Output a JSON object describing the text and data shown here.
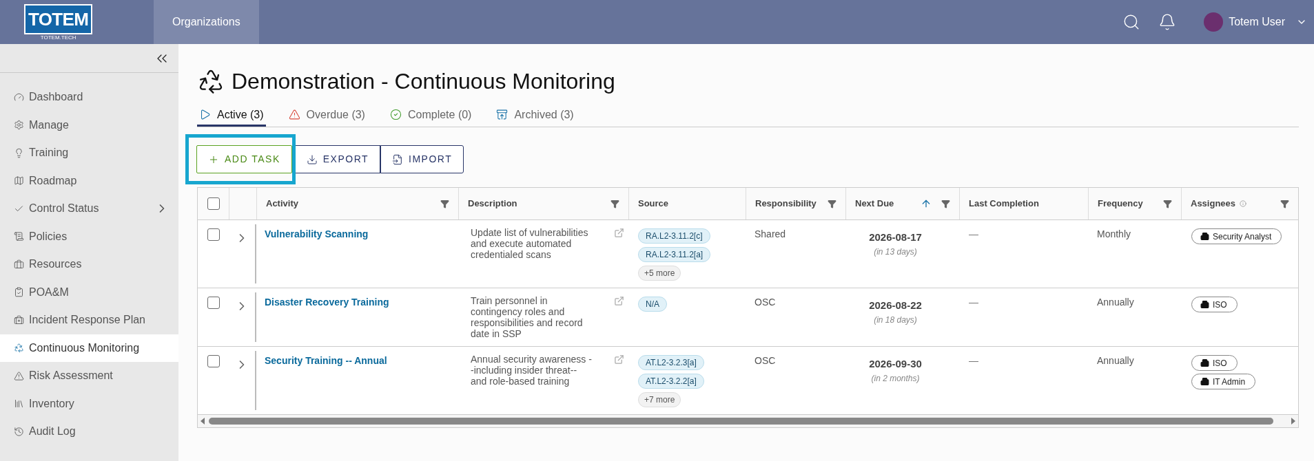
{
  "header": {
    "logo": {
      "text": "TOTEM",
      "subtext": "TOTEM.TECH"
    },
    "nav": [
      {
        "label": "Organizations",
        "selected": true
      }
    ],
    "user": {
      "name": "Totem User"
    }
  },
  "sidebar": {
    "items": [
      {
        "label": "Dashboard",
        "selected": false,
        "expandable": false
      },
      {
        "label": "Manage",
        "selected": false,
        "expandable": false
      },
      {
        "label": "Training",
        "selected": false,
        "expandable": false
      },
      {
        "label": "Roadmap",
        "selected": false,
        "expandable": false
      },
      {
        "label": "Control Status",
        "selected": false,
        "expandable": true
      },
      {
        "label": "Policies",
        "selected": false,
        "expandable": false
      },
      {
        "label": "Resources",
        "selected": false,
        "expandable": false
      },
      {
        "label": "POA&M",
        "selected": false,
        "expandable": false
      },
      {
        "label": "Incident Response Plan",
        "selected": false,
        "expandable": false
      },
      {
        "label": "Continuous Monitoring",
        "selected": true,
        "expandable": false
      },
      {
        "label": "Risk Assessment",
        "selected": false,
        "expandable": false
      },
      {
        "label": "Inventory",
        "selected": false,
        "expandable": false
      },
      {
        "label": "Audit Log",
        "selected": false,
        "expandable": false
      }
    ]
  },
  "page": {
    "title": "Demonstration - Continuous Monitoring",
    "tabs": [
      {
        "label": "Active (3)",
        "kind": "active",
        "selected": true
      },
      {
        "label": "Overdue (3)",
        "kind": "overdue",
        "selected": false
      },
      {
        "label": "Complete (0)",
        "kind": "complete",
        "selected": false
      },
      {
        "label": "Archived (3)",
        "kind": "archived",
        "selected": false
      }
    ],
    "buttons": [
      {
        "label": "ADD TASK",
        "kind": "add",
        "highlighted": true
      },
      {
        "label": "EXPORT",
        "kind": "export",
        "highlighted": false
      },
      {
        "label": "IMPORT",
        "kind": "import",
        "highlighted": false
      }
    ]
  },
  "table": {
    "select_all": {
      "checked": false
    },
    "columns": [
      {
        "label": "Activity",
        "filter": true,
        "sorted": false,
        "info": false
      },
      {
        "label": "Description",
        "filter": true,
        "sorted": false,
        "info": false
      },
      {
        "label": "Source",
        "filter": false,
        "sorted": false,
        "info": false
      },
      {
        "label": "Responsibility",
        "filter": true,
        "sorted": false,
        "info": false
      },
      {
        "label": "Next Due",
        "filter": true,
        "sorted": true,
        "info": false
      },
      {
        "label": "Last Completion",
        "filter": false,
        "sorted": false,
        "info": false
      },
      {
        "label": "Frequency",
        "filter": true,
        "sorted": false,
        "info": false
      },
      {
        "label": "Assignees",
        "filter": true,
        "sorted": false,
        "info": true
      }
    ],
    "rows": [
      {
        "checked": false,
        "expanded": false,
        "activity": "Vulnerability Scanning",
        "description": "Update list of vulnerabilities and execute automated credentialed scans",
        "sources": [
          "RA.L2-3.11.2[c]",
          "RA.L2-3.11.2[a]"
        ],
        "more": "+5 more",
        "responsibility": "Shared",
        "next_due": "2026-08-17",
        "next_due_relative": "(in 13 days)",
        "last_completion": "—",
        "frequency": "Monthly",
        "assignees": [
          "Security Analyst"
        ]
      },
      {
        "checked": false,
        "expanded": false,
        "activity": "Disaster Recovery Training",
        "description": "Train personnel in contingency roles and responsibilities and record date in SSP",
        "sources": [
          "N/A"
        ],
        "responsibility": "OSC",
        "next_due": "2026-08-22",
        "next_due_relative": "(in 18 days)",
        "last_completion": "—",
        "frequency": "Annually",
        "assignees": [
          "ISO"
        ]
      },
      {
        "checked": false,
        "expanded": false,
        "activity": "Security Training -- Annual",
        "description": "Annual security awareness --including insider threat-- and role-based training",
        "sources": [
          "AT.L2-3.2.3[a]",
          "AT.L2-3.2.2[a]"
        ],
        "more": "+7 more",
        "responsibility": "OSC",
        "next_due": "2026-09-30",
        "next_due_relative": "(in 2 months)",
        "last_completion": "—",
        "frequency": "Annually",
        "assignees": [
          "ISO",
          "IT Admin"
        ]
      }
    ]
  }
}
